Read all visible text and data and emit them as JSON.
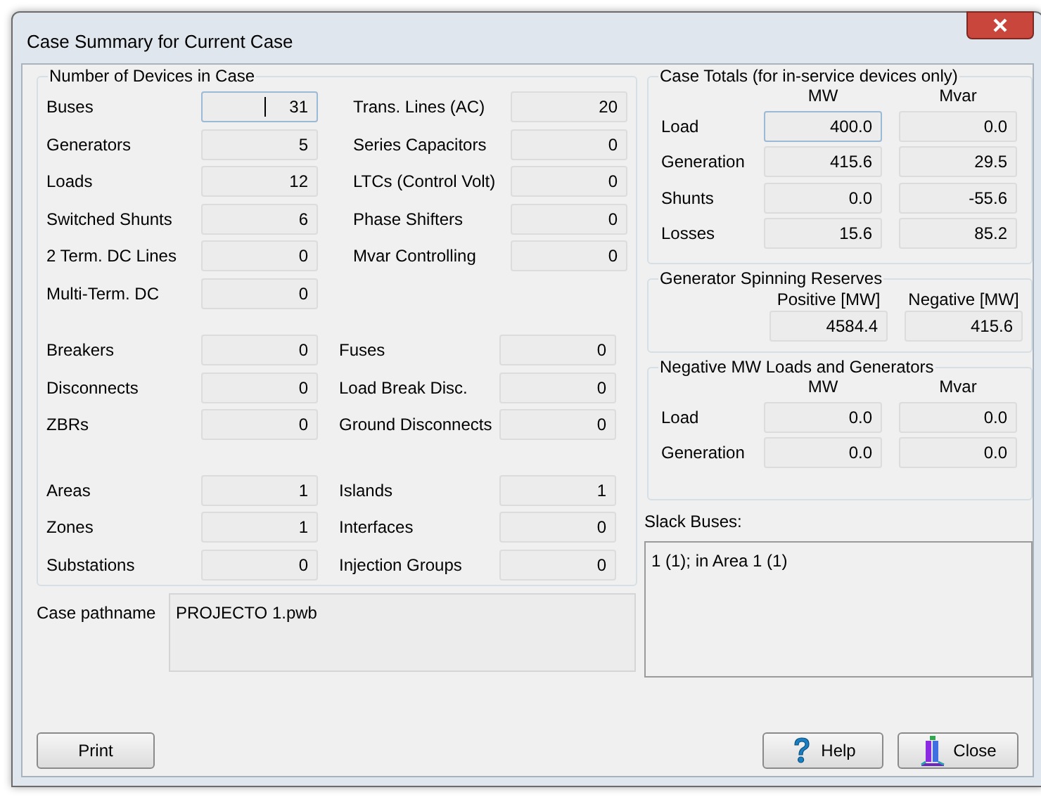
{
  "window": {
    "title": "Case Summary for Current Case"
  },
  "devices": {
    "title": "Number of Devices in Case",
    "sections": [
      {
        "rows": [
          [
            {
              "label": "Buses",
              "value": "31",
              "focused": true
            },
            {
              "label": "Trans. Lines (AC)",
              "value": "20",
              "focused": false
            }
          ],
          [
            {
              "label": "Generators",
              "value": "5",
              "focused": false
            },
            {
              "label": "Series Capacitors",
              "value": "0",
              "focused": false
            }
          ],
          [
            {
              "label": "Loads",
              "value": "12",
              "focused": false
            },
            {
              "label": "LTCs (Control Volt)",
              "value": "0",
              "focused": false
            }
          ],
          [
            {
              "label": "Switched Shunts",
              "value": "6",
              "focused": false
            },
            {
              "label": "Phase Shifters",
              "value": "0",
              "focused": false
            }
          ],
          [
            {
              "label": "2 Term. DC Lines",
              "value": "0",
              "focused": false
            },
            {
              "label": "Mvar Controlling",
              "value": "0",
              "focused": false
            }
          ],
          [
            {
              "label": "Multi-Term. DC",
              "value": "0",
              "focused": false
            }
          ]
        ]
      },
      {
        "rows": [
          [
            {
              "label": "Breakers",
              "value": "0",
              "focused": false
            },
            {
              "label": "Fuses",
              "value": "0",
              "focused": false
            }
          ],
          [
            {
              "label": "Disconnects",
              "value": "0",
              "focused": false
            },
            {
              "label": "Load Break Disc.",
              "value": "0",
              "focused": false
            }
          ],
          [
            {
              "label": "ZBRs",
              "value": "0",
              "focused": false
            },
            {
              "label": "Ground Disconnects",
              "value": "0",
              "focused": false
            }
          ]
        ]
      },
      {
        "rows": [
          [
            {
              "label": "Areas",
              "value": "1",
              "focused": false
            },
            {
              "label": "Islands",
              "value": "1",
              "focused": false
            }
          ],
          [
            {
              "label": "Zones",
              "value": "1",
              "focused": false
            },
            {
              "label": "Interfaces",
              "value": "0",
              "focused": false
            }
          ],
          [
            {
              "label": "Substations",
              "value": "0",
              "focused": false
            },
            {
              "label": "Injection Groups",
              "value": "0",
              "focused": false
            }
          ]
        ]
      }
    ]
  },
  "case_pathname": {
    "label": "Case pathname",
    "value": "PROJECTO 1.pwb"
  },
  "case_totals": {
    "title": "Case Totals (for in-service devices only)",
    "columns": [
      "MW",
      "Mvar"
    ],
    "rows": [
      {
        "label": "Load",
        "cells": [
          {
            "value": "400.0",
            "focused": true
          },
          {
            "value": "0.0",
            "focused": false
          }
        ]
      },
      {
        "label": "Generation",
        "cells": [
          {
            "value": "415.6",
            "focused": false
          },
          {
            "value": "29.5",
            "focused": false
          }
        ]
      },
      {
        "label": "Shunts",
        "cells": [
          {
            "value": "0.0",
            "focused": false
          },
          {
            "value": "-55.6",
            "focused": false
          }
        ]
      },
      {
        "label": "Losses",
        "cells": [
          {
            "value": "15.6",
            "focused": false
          },
          {
            "value": "85.2",
            "focused": false
          }
        ]
      }
    ]
  },
  "spinning_reserves": {
    "title": "Generator Spinning Reserves",
    "columns": [
      "Positive [MW]",
      "Negative [MW]"
    ],
    "values": [
      "4584.4",
      "415.6"
    ]
  },
  "negative_loads": {
    "title": "Negative MW Loads and Generators",
    "columns": [
      "MW",
      "Mvar"
    ],
    "rows": [
      {
        "label": "Load",
        "cells": [
          {
            "value": "0.0",
            "focused": false
          },
          {
            "value": "0.0",
            "focused": false
          }
        ]
      },
      {
        "label": "Generation",
        "cells": [
          {
            "value": "0.0",
            "focused": false
          },
          {
            "value": "0.0",
            "focused": false
          }
        ]
      }
    ]
  },
  "slack_buses": {
    "label": "Slack Buses:",
    "value": "1 (1); in Area 1 (1)"
  },
  "buttons": [
    {
      "label": "Print",
      "kind": "plain"
    },
    {
      "label": "Help",
      "kind": "help"
    },
    {
      "label": "Close",
      "kind": "close"
    }
  ]
}
